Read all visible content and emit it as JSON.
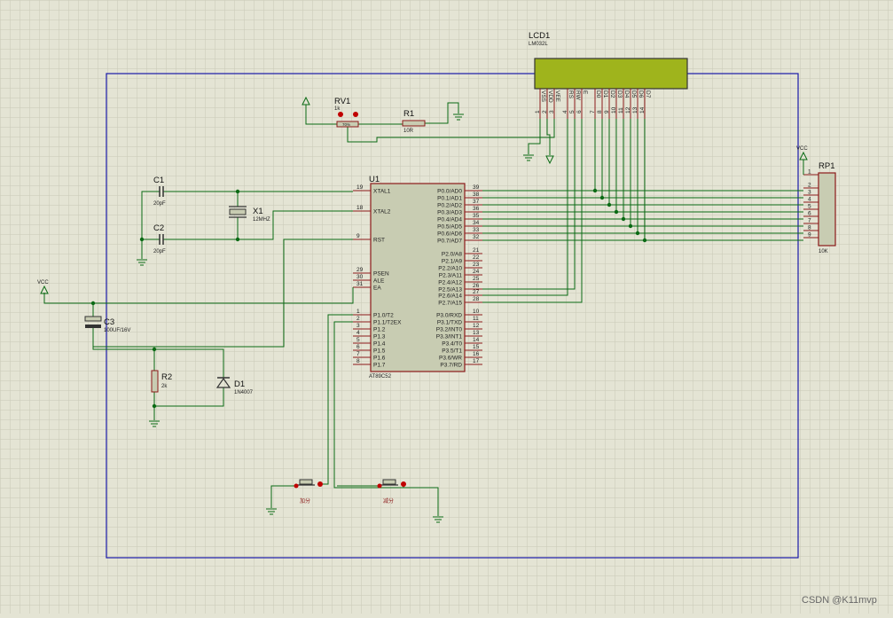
{
  "colors": {
    "background": "#e4e4d4",
    "grid": "#c9c9b6",
    "border": "#1a1aa8",
    "wire": "#0a6a14",
    "body_outline": "#8b1a1a",
    "body_fill": "#c8ccb2",
    "lcd_fill": "#9fb41c",
    "power_symbol": "#0a6a14",
    "pin_dot": "#c00000"
  },
  "lcd": {
    "ref": "LCD1",
    "model": "LM032L",
    "pin_names": [
      "VSS",
      "VDD",
      "VEE",
      "RS",
      "RW",
      "E",
      "D0",
      "D1",
      "D2",
      "D3",
      "D4",
      "D5",
      "D6",
      "D7"
    ],
    "pin_numbers": [
      "1",
      "2",
      "3",
      "4",
      "5",
      "6",
      "7",
      "8",
      "9",
      "10",
      "11",
      "12",
      "13",
      "14"
    ]
  },
  "mcu": {
    "ref": "U1",
    "part": "AT89C52",
    "left_pins": [
      {
        "num": "19",
        "name": "XTAL1"
      },
      {
        "num": "18",
        "name": "XTAL2"
      },
      {
        "num": "9",
        "name": "RST"
      },
      {
        "num": "29",
        "name": "PSEN"
      },
      {
        "num": "30",
        "name": "ALE"
      },
      {
        "num": "31",
        "name": "EA"
      },
      {
        "num": "1",
        "name": "P1.0/T2"
      },
      {
        "num": "2",
        "name": "P1.1/T2EX"
      },
      {
        "num": "3",
        "name": "P1.2"
      },
      {
        "num": "4",
        "name": "P1.3"
      },
      {
        "num": "5",
        "name": "P1.4"
      },
      {
        "num": "6",
        "name": "P1.5"
      },
      {
        "num": "7",
        "name": "P1.6"
      },
      {
        "num": "8",
        "name": "P1.7"
      }
    ],
    "right_pins": [
      {
        "num": "39",
        "name": "P0.0/AD0"
      },
      {
        "num": "38",
        "name": "P0.1/AD1"
      },
      {
        "num": "37",
        "name": "P0.2/AD2"
      },
      {
        "num": "36",
        "name": "P0.3/AD3"
      },
      {
        "num": "35",
        "name": "P0.4/AD4"
      },
      {
        "num": "34",
        "name": "P0.5/AD5"
      },
      {
        "num": "33",
        "name": "P0.6/AD6"
      },
      {
        "num": "32",
        "name": "P0.7/AD7"
      },
      {
        "num": "21",
        "name": "P2.0/A8"
      },
      {
        "num": "22",
        "name": "P2.1/A9"
      },
      {
        "num": "23",
        "name": "P2.2/A10"
      },
      {
        "num": "24",
        "name": "P2.3/A11"
      },
      {
        "num": "25",
        "name": "P2.4/A12"
      },
      {
        "num": "26",
        "name": "P2.5/A13"
      },
      {
        "num": "27",
        "name": "P2.6/A14"
      },
      {
        "num": "28",
        "name": "P2.7/A15"
      },
      {
        "num": "10",
        "name": "P3.0/RXD"
      },
      {
        "num": "11",
        "name": "P3.1/TXD"
      },
      {
        "num": "12",
        "name": "P3.2/INT0"
      },
      {
        "num": "13",
        "name": "P3.3/INT1"
      },
      {
        "num": "14",
        "name": "P3.4/T0"
      },
      {
        "num": "15",
        "name": "P3.5/T1"
      },
      {
        "num": "16",
        "name": "P3.6/WR"
      },
      {
        "num": "17",
        "name": "P3.7/RD"
      }
    ]
  },
  "components": {
    "rv1": {
      "ref": "RV1",
      "value": "1k",
      "inner": "70%"
    },
    "r1": {
      "ref": "R1",
      "value": "10R"
    },
    "c1": {
      "ref": "C1",
      "value": "20pF"
    },
    "c2": {
      "ref": "C2",
      "value": "20pF"
    },
    "x1": {
      "ref": "X1",
      "value": "12MHZ"
    },
    "c3": {
      "ref": "C3",
      "value": "100UF/16V"
    },
    "r2": {
      "ref": "R2",
      "value": "2k"
    },
    "d1": {
      "ref": "D1",
      "value": "1N4007"
    },
    "rp1": {
      "ref": "RP1",
      "value": "10K",
      "pins": [
        "1",
        "2",
        "3",
        "4",
        "5",
        "6",
        "7",
        "8",
        "9"
      ]
    },
    "btn1": {
      "label": "加分"
    },
    "btn2": {
      "label": "减分"
    }
  },
  "power": {
    "vcc_label": "VCC"
  },
  "watermark": "CSDN @K11mvp"
}
